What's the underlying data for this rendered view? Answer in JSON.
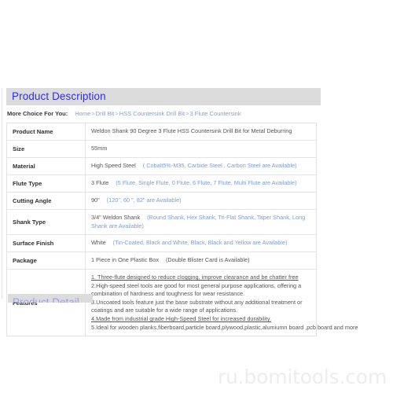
{
  "section": {
    "title": "Product Description"
  },
  "breadcrumb": {
    "label": "More Choice For You:",
    "items": [
      "Home",
      "Drill Bit",
      "HSS Countersink Drill Bit",
      "3 Flute Countersink"
    ],
    "separator": ">"
  },
  "spec_table": {
    "rows": [
      {
        "key": "Product Name",
        "value": "Weldon Shank 90 Degree 3 Flute HSS Countersink Drill Bit  for Metal Deburring",
        "options": ""
      },
      {
        "key": "Size",
        "value": "55mm",
        "options": ""
      },
      {
        "key": "Material",
        "value": "High Speed Steel",
        "options": "( Cobalt5%-M35, Carbide Steel , Carbon Steel are Available)"
      },
      {
        "key": "Flute Type",
        "value": "3 Flute",
        "options": "(5 Flute, Single Flute, 0 Flute,  6 Flute, 7 Flute, Multi Flute are Available)"
      },
      {
        "key": "Cutting Angle",
        "value": "90\"",
        "options": "(120\", 60 \", 82\" are Available)"
      },
      {
        "key": "Shank Type",
        "value": "3/4\" Weldon Shank",
        "options": "(Round Shank, Hex Shank,  Tri-Flat Shank, Taper Shank,  Long Shank  are Available)"
      },
      {
        "key": "Surface Finish",
        "value": "White",
        "options": "(Tin-Coated, Black and White, Black, Black and Yellow are Available)"
      },
      {
        "key": "Package",
        "value": "1 Piece in One Plastic Box",
        "options": "(Double Blister Card is Available)"
      }
    ],
    "features": {
      "key": "Features",
      "lines": [
        "1. Three-flute designed to reduce clogging, improve clearance and be chatter free",
        "2.High-speed steel tools are good for most general purpose applications, offering a combination of hardness and toughness for wear resistance.",
        "3.Uncoated tools feature just the base substrate without any additional treatment or coatings and are suitable for a wide range of applications.",
        "4.Made from industrial grade High-Speed Steel for increased durability.",
        "5.Ideal for wooden planks,fiberboard,particle board,plywood,plastic,alumiumn board ,pcb board and more"
      ]
    }
  },
  "next_section": {
    "title": "Product Detail"
  },
  "watermark": {
    "text": "ru.bomitools.com"
  },
  "colors": {
    "header_bar": "#dcdcdc",
    "header_title": "#2b2bf5",
    "option_text": "#7b9cd4",
    "body_text": "#555555",
    "table_border": "#e3e3e3",
    "watermark": "#ededed"
  }
}
